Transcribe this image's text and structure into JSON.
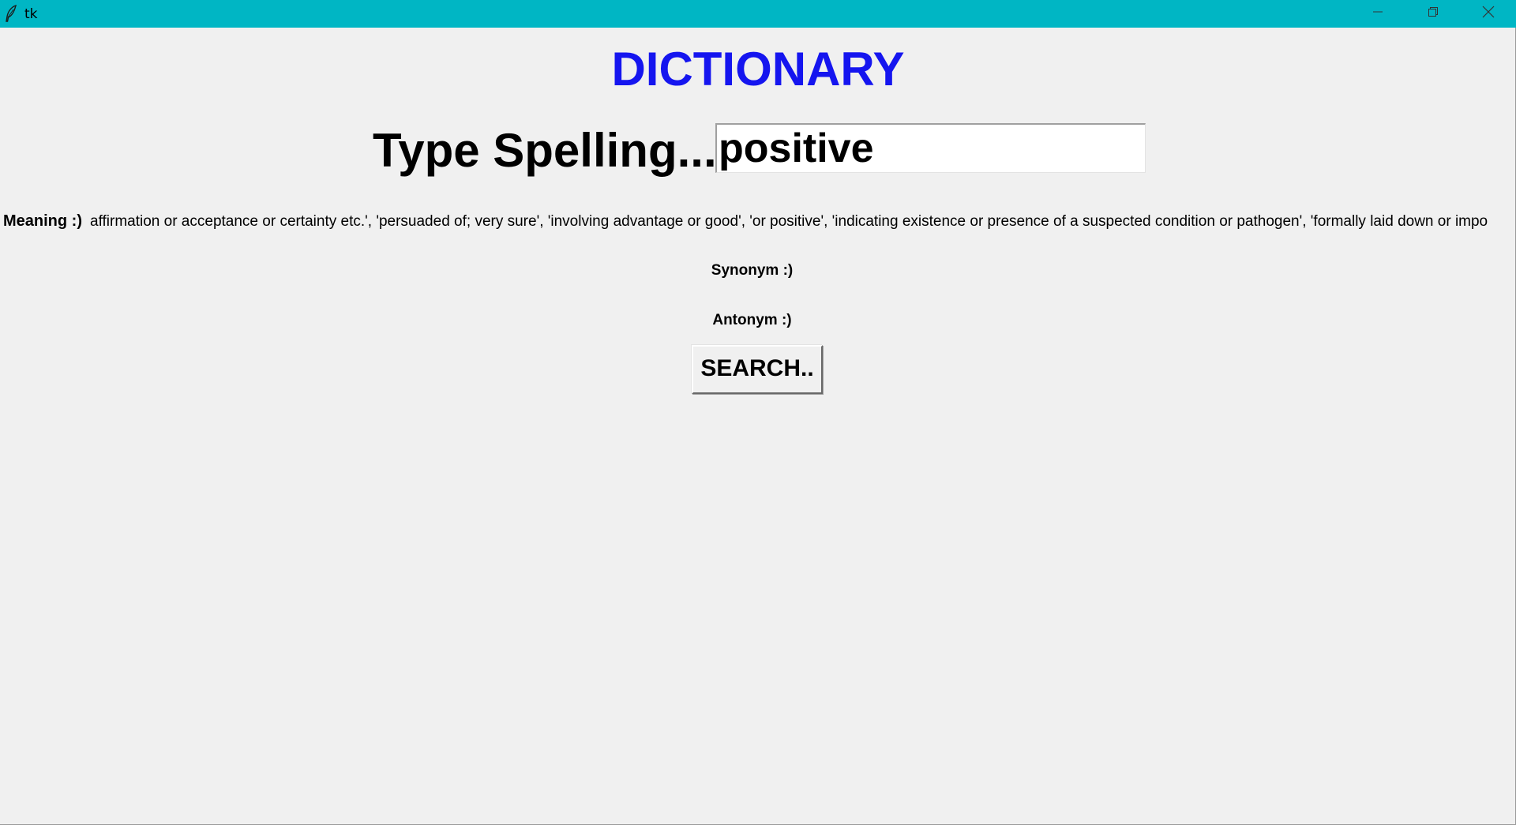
{
  "window": {
    "title": "tk",
    "titlebar_color": "#00b6c4",
    "controls": {
      "minimize_icon": "minimize-icon",
      "restore_icon": "restore-icon",
      "close_icon": "close-icon"
    }
  },
  "app": {
    "heading": "DICTIONARY",
    "heading_color": "#1515ef",
    "type_spelling_label": "Type Spelling...",
    "word_input_value": "positive",
    "meaning_label": "Meaning :)",
    "meaning_text": "affirmation or acceptance or certainty etc.', 'persuaded of; very sure', 'involving advantage or good', 'or positive', 'indicating existence or presence of a suspected condition or pathogen', 'formally laid down or impo",
    "synonym_label": "Synonym :)",
    "antonym_label": "Antonym :)",
    "search_button": "SEARCH.."
  }
}
